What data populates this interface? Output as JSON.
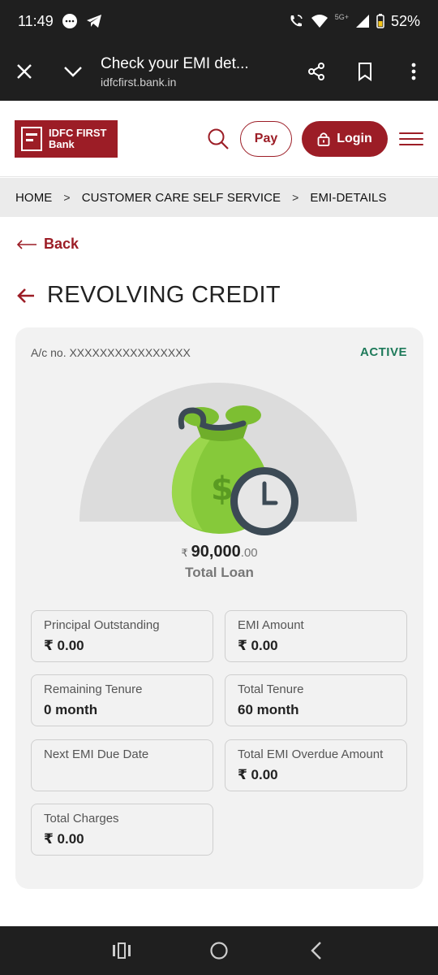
{
  "status_bar": {
    "time": "11:49",
    "network": "5G+",
    "battery": "52%",
    "icons": [
      "messenger-icon",
      "telegram-icon",
      "wifi-call-icon",
      "wifi-icon",
      "signal-icon",
      "battery-icon"
    ]
  },
  "browser": {
    "title": "Check your EMI det...",
    "url": "idfcfirst.bank.in"
  },
  "header": {
    "logo_line1": "IDFC FIRST",
    "logo_line2": "Bank",
    "pay_label": "Pay",
    "login_label": "Login"
  },
  "breadcrumb": {
    "items": [
      "HOME",
      "CUSTOMER CARE SELF SERVICE",
      "EMI-DETAILS"
    ],
    "separator": ">"
  },
  "back_label": "Back",
  "page_title": "REVOLVING CREDIT",
  "card": {
    "account_no": "A/c no. XXXXXXXXXXXXXXXX",
    "status": "ACTIVE",
    "currency_symbol": "₹",
    "amount_main": "90,000",
    "amount_decimal": ".00",
    "amount_caption": "Total Loan",
    "tiles": [
      {
        "label": "Principal Outstanding",
        "value": "₹ 0.00"
      },
      {
        "label": "EMI Amount",
        "value": "₹ 0.00"
      },
      {
        "label": "Remaining Tenure",
        "value": "0 month"
      },
      {
        "label": "Total Tenure",
        "value": "60 month"
      },
      {
        "label": "Next EMI Due Date",
        "value": ""
      },
      {
        "label": "Total EMI Overdue Amount",
        "value": "₹ 0.00"
      },
      {
        "label": "Total Charges",
        "value": "₹ 0.00"
      }
    ]
  },
  "colors": {
    "brand": "#9c1d26",
    "active": "#1e7a5a",
    "bag_green": "#7cc22e"
  }
}
